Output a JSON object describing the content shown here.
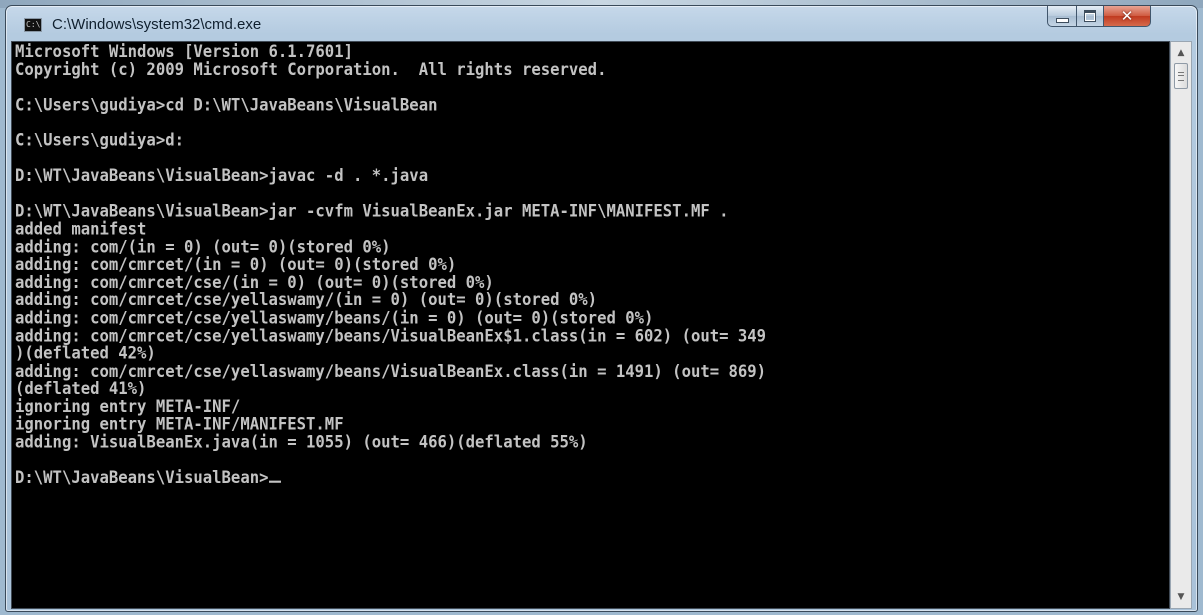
{
  "window": {
    "title": "C:\\Windows\\system32\\cmd.exe",
    "icon_text": "C:\\",
    "buttons": {
      "minimize": "minimize-icon",
      "maximize": "maximize-icon",
      "close": "✕"
    }
  },
  "console": {
    "lines": [
      "Microsoft Windows [Version 6.1.7601]",
      "Copyright (c) 2009 Microsoft Corporation.  All rights reserved.",
      "",
      "C:\\Users\\gudiya>cd D:\\WT\\JavaBeans\\VisualBean",
      "",
      "C:\\Users\\gudiya>d:",
      "",
      "D:\\WT\\JavaBeans\\VisualBean>javac -d . *.java",
      "",
      "D:\\WT\\JavaBeans\\VisualBean>jar -cvfm VisualBeanEx.jar META-INF\\MANIFEST.MF .",
      "added manifest",
      "adding: com/(in = 0) (out= 0)(stored 0%)",
      "adding: com/cmrcet/(in = 0) (out= 0)(stored 0%)",
      "adding: com/cmrcet/cse/(in = 0) (out= 0)(stored 0%)",
      "adding: com/cmrcet/cse/yellaswamy/(in = 0) (out= 0)(stored 0%)",
      "adding: com/cmrcet/cse/yellaswamy/beans/(in = 0) (out= 0)(stored 0%)",
      "adding: com/cmrcet/cse/yellaswamy/beans/VisualBeanEx$1.class(in = 602) (out= 349",
      ")(deflated 42%)",
      "adding: com/cmrcet/cse/yellaswamy/beans/VisualBeanEx.class(in = 1491) (out= 869)",
      "(deflated 41%)",
      "ignoring entry META-INF/",
      "ignoring entry META-INF/MANIFEST.MF",
      "adding: VisualBeanEx.java(in = 1055) (out= 466)(deflated 55%)",
      ""
    ],
    "prompt": "D:\\WT\\JavaBeans\\VisualBean>"
  },
  "scrollbar": {
    "up_icon": "▲",
    "down_icon": "▼"
  },
  "colors": {
    "console_bg": "#000000",
    "console_fg": "#c3c3c3",
    "close_button": "#c7402a"
  }
}
